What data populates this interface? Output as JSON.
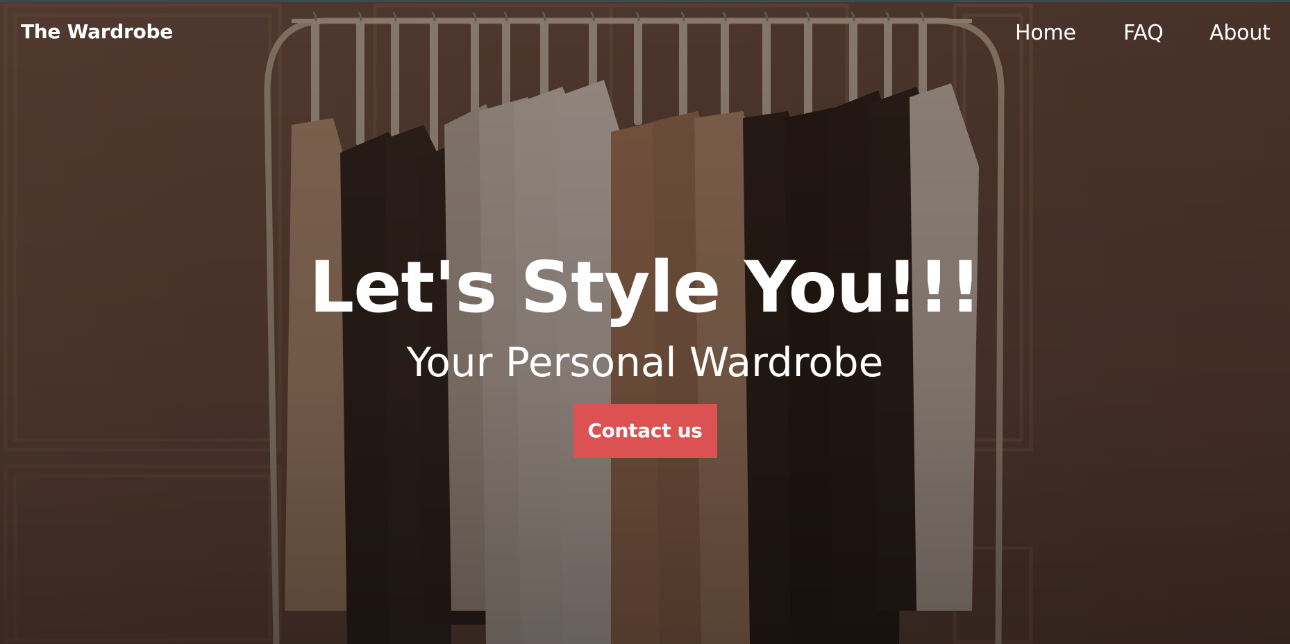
{
  "nav": {
    "brand": "The Wardrobe",
    "links": [
      "Home",
      "FAQ",
      "About"
    ]
  },
  "hero": {
    "title": "Let's Style You!!!",
    "subtitle": "Your Personal Wardrobe",
    "cta_label": "Contact us",
    "background_image": "clothing-rack-photo"
  },
  "colors": {
    "overlay_base": "#3d2a22",
    "cta_background": "#dc5252",
    "text": "#ffffff"
  }
}
